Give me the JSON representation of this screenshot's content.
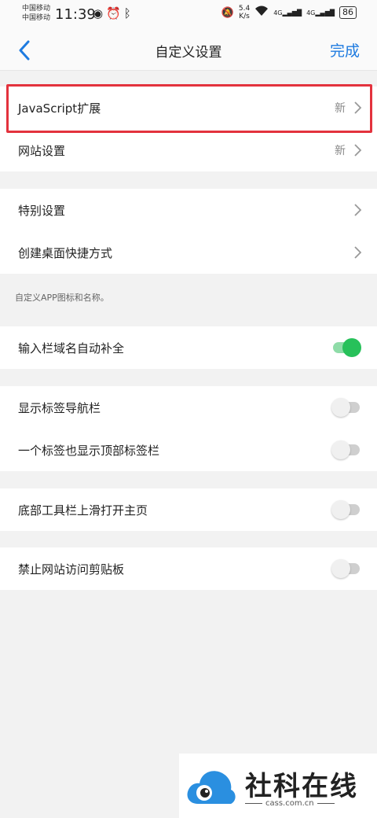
{
  "status_bar": {
    "carrier_1": "中国移动",
    "carrier_2": "中国移动",
    "time": "11:39",
    "net_speed_value": "5.4",
    "net_speed_unit": "K/s",
    "signal_1": "4G",
    "signal_2": "4G",
    "battery": "86"
  },
  "nav": {
    "title": "自定义设置",
    "done_label": "完成"
  },
  "groups": {
    "g1": [
      {
        "label": "JavaScript扩展",
        "badge": "新"
      },
      {
        "label": "网站设置",
        "badge": "新"
      }
    ],
    "g2": [
      {
        "label": "特别设置"
      },
      {
        "label": "创建桌面快捷方式"
      }
    ],
    "g2_hint": "自定义APP图标和名称。",
    "g3": [
      {
        "label": "输入栏域名自动补全",
        "enabled": true
      }
    ],
    "g4": [
      {
        "label": "显示标签导航栏",
        "enabled": false
      },
      {
        "label": "一个标签也显示顶部标签栏",
        "enabled": false
      }
    ],
    "g5": [
      {
        "label": "底部工具栏上滑打开主页",
        "enabled": false
      }
    ],
    "g6": [
      {
        "label": "禁止网站访问剪贴板",
        "enabled": false
      }
    ]
  },
  "colors": {
    "accent": "#1e7be0",
    "toggle_on": "#27c15a",
    "highlight": "#e3323d"
  },
  "watermark": {
    "brand": "社科在线",
    "url": "cass.com.cn"
  }
}
